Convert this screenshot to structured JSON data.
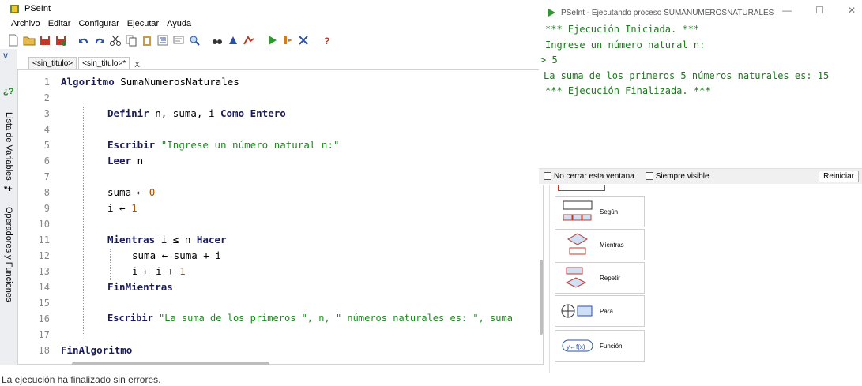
{
  "main_window": {
    "title": "PSeInt",
    "menu": [
      "Archivo",
      "Editar",
      "Configurar",
      "Ejecutar",
      "Ayuda"
    ],
    "tabs": [
      {
        "label": "<sin_titulo>",
        "active": false
      },
      {
        "label": "<sin_titulo>*",
        "active": true
      }
    ],
    "tab_close": "X"
  },
  "sidebar": {
    "var_list_label": "Lista de Variables",
    "ops_label": "Operadores y Funciones"
  },
  "editor": {
    "line_numbers": [
      "1",
      "2",
      "3",
      "4",
      "5",
      "6",
      "7",
      "8",
      "9",
      "10",
      "11",
      "12",
      "13",
      "14",
      "15",
      "16",
      "17",
      "18"
    ],
    "code": {
      "l1_kw": "Algoritmo",
      "l1_name": " SumaNumerosNaturales",
      "l3_kw": "Definir",
      "l3_mid": " n, suma, i ",
      "l3_kw2": "Como Entero",
      "l5_kw": "Escribir",
      "l5_str": " \"Ingrese un número natural n:\"",
      "l6_kw": "Leer",
      "l6_var": " n",
      "l8_var": "suma ← ",
      "l8_num": "0",
      "l9_var": "i ← ",
      "l9_num": "1",
      "l11_kw": "Mientras",
      "l11_mid": " i ≤ n ",
      "l11_kw2": "Hacer",
      "l12": "suma ← suma + i",
      "l13_var": "i ← i + ",
      "l13_num": "1",
      "l14_kw": "FinMientras",
      "l16_kw": "Escribir",
      "l16_rest": " \"La suma de los primeros \", n, \" números naturales es: \", suma",
      "l18_kw": "FinAlgoritmo"
    }
  },
  "status_bar": "La ejecución ha finalizado sin errores.",
  "console": {
    "title": "PSeInt - Ejecutando proceso SUMANUMEROSNATURALES",
    "lines": [
      "*** Ejecución Iniciada. ***",
      "Ingrese un número natural n:",
      "> 5",
      "La suma de los primeros 5 números naturales es: 15",
      "*** Ejecución Finalizada. ***"
    ],
    "keep_open_label": "No cerrar esta ventana",
    "always_visible_label": "Siempre visible",
    "restart_label": "Reiniciar"
  },
  "shapes_panel": {
    "items": [
      "Según",
      "Mientras",
      "Repetir",
      "Para",
      "Función"
    ]
  }
}
